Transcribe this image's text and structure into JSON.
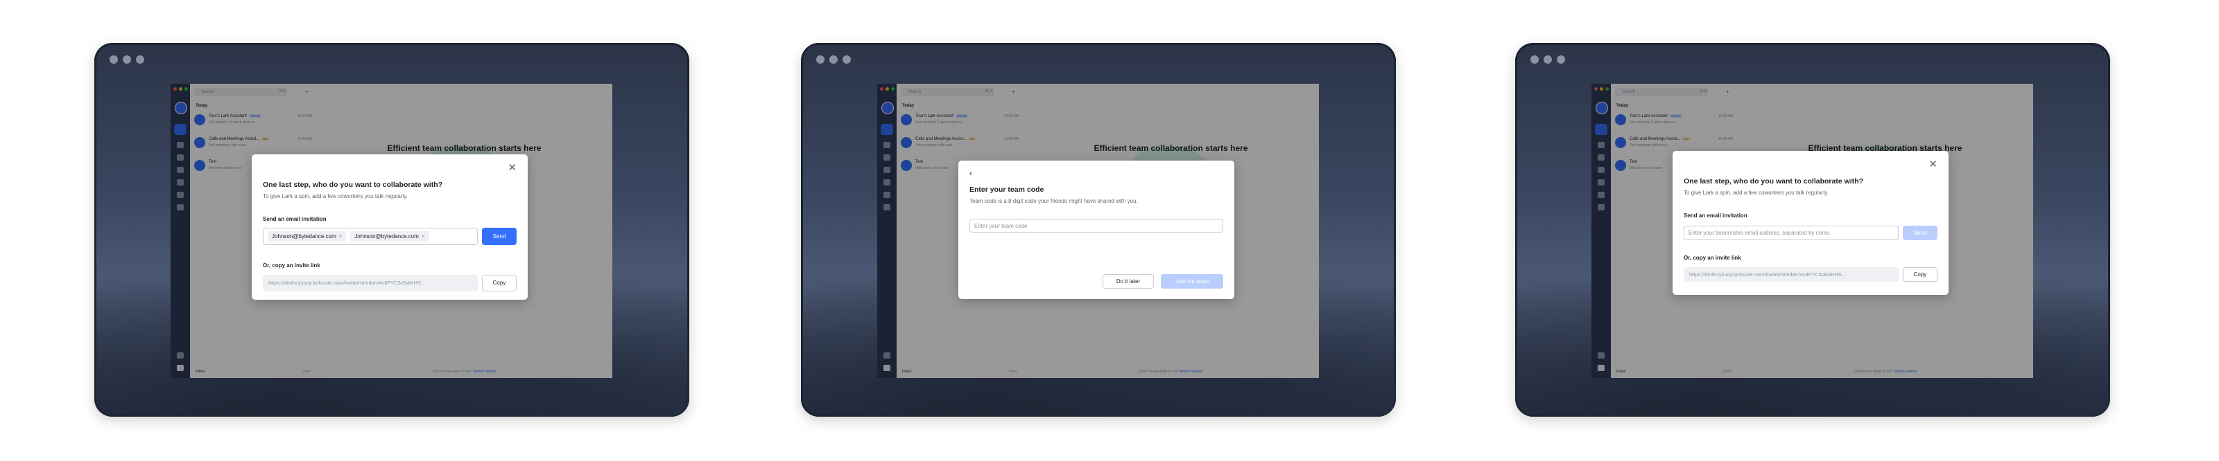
{
  "colors": {
    "accent": "#3370ff",
    "rail": "#2e3a56",
    "send_disabled": "#bacefd"
  },
  "app": {
    "search_placeholder": "Search",
    "search_shortcut": "⌘+K",
    "today_label": "Today",
    "chats": [
      {
        "name": "Tour's Lark Assistant",
        "tag": "Official",
        "time": "10:00 AM",
        "sub": "Get started in 3 quick steps to..."
      },
      {
        "name": "Calls and Meetings Assist...",
        "tag": "Bot",
        "time": "10:00 AM",
        "sub": "Join meetings with ease..."
      },
      {
        "name": "Test",
        "tag": "",
        "time": "",
        "sub": "Welcome to the team"
      }
    ],
    "bottom_left": "Inbox",
    "bottom_right": "Done",
    "hero": "Efficient team collaboration starts here",
    "footer_prefix": "Don't know what to do? ",
    "footer_link": "Watch videos"
  },
  "screens": [
    {
      "title": "One last step, who do you want to collaborate with?",
      "subtitle": "To give Lark a spin, add a few coworkers you talk regularly.",
      "email_label": "Send an email invitation",
      "chips": [
        "Johnson@bytedance.com",
        "Johnson@bytedance.com"
      ],
      "send_label": "Send",
      "link_label": "Or, copy an invite link",
      "link_value": "https://dmthcysuoy.larksuite.com/invite/member/4c8FYC5cBAKHS...",
      "copy_label": "Copy"
    },
    {
      "title": "Enter your team code",
      "subtitle": "Team code is a 8 digit code your friends might have shared with you.",
      "input_placeholder": "Enter your team code",
      "later_label": "Do it later",
      "join_label": "Join the team"
    },
    {
      "title": "One last step, who do you want to collaborate with?",
      "subtitle": "To give Lark a spin, add a few coworkers you talk regularly.",
      "email_label": "Send an email invitation",
      "input_placeholder": "Enter your teammates email address, separated by coma",
      "send_label": "Send",
      "link_label": "Or, copy an invite link",
      "link_value": "https://dmthcysuoy.larksuite.com/invite/member/4c8FYC5cBAKHS...",
      "copy_label": "Copy"
    }
  ]
}
